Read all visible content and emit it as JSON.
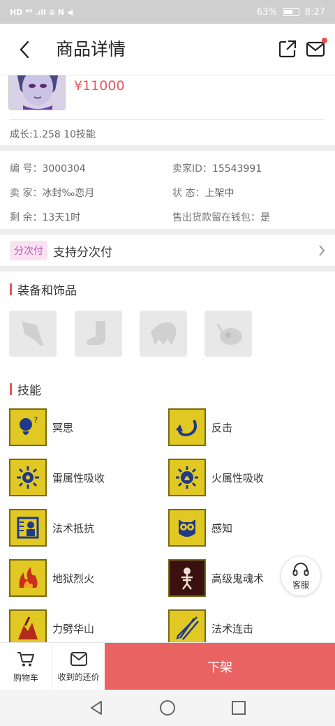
{
  "status_bar": {
    "left": "HD ⁴ᴳ .ıll ≋ N ◀",
    "battery": "63%",
    "time": "8:27"
  },
  "header": {
    "title": "商品详情"
  },
  "item": {
    "price": "¥11000",
    "growth": "成长:1.258 10技能"
  },
  "info": [
    {
      "label": "编  号：",
      "value": "3000304"
    },
    {
      "label": "卖家ID：",
      "value": "15543991"
    },
    {
      "label": "卖  家：",
      "value": "冰封‰恋月"
    },
    {
      "label": "状  态：",
      "value": "上架中"
    },
    {
      "label": "剩  余：",
      "value": "13天1时"
    },
    {
      "label": "售出货款留在钱包：",
      "value": "是"
    }
  ],
  "installment": {
    "tag": "分次付",
    "text": "支持分次付"
  },
  "equipment": {
    "title": "装备和饰品"
  },
  "skills": {
    "title": "技能",
    "items": [
      "冥思",
      "反击",
      "雷属性吸收",
      "火属性吸收",
      "法术抵抗",
      "感知",
      "地狱烈火",
      "高级鬼魂术",
      "力劈华山",
      "法术连击"
    ]
  },
  "kefu": "客服",
  "bottom_bar": {
    "cart": "购物车",
    "offers": "收到的还价",
    "remove": "下架"
  },
  "colors": {
    "accent": "#e96363",
    "price": "#e8585d",
    "tag_bg": "#f9e3f3",
    "tag_text": "#c755b4",
    "skill_icon": "#e2c822"
  }
}
